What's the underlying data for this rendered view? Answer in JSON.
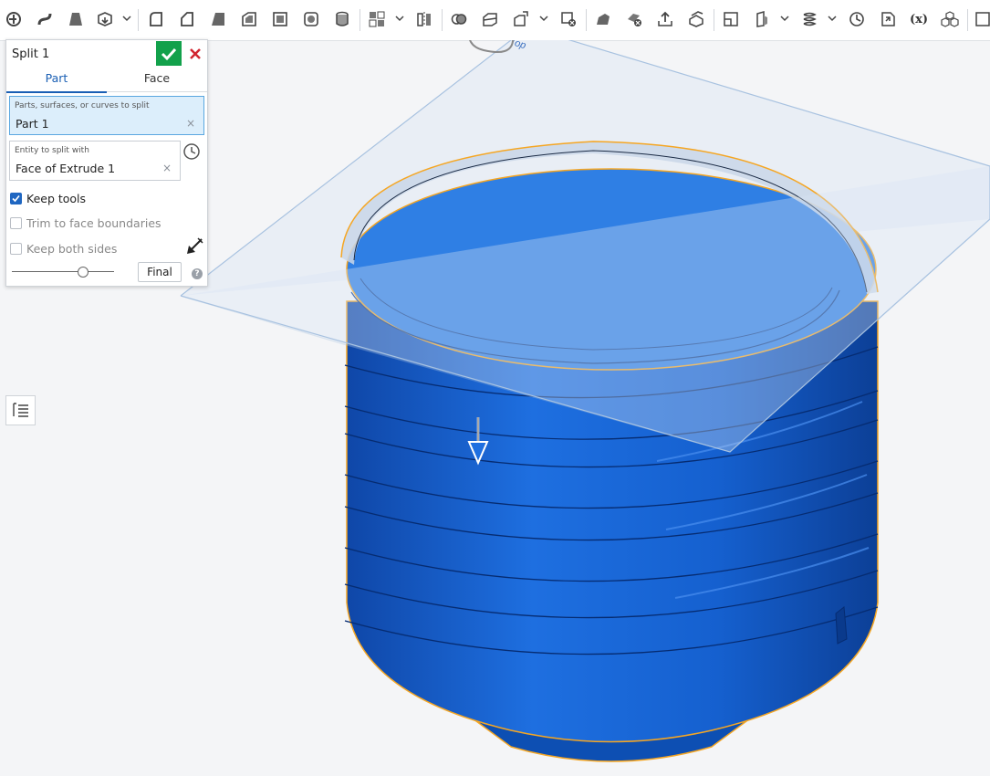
{
  "toolbar": {
    "icons": [
      "sweep-icon",
      "extrude-icon",
      "loft-icon",
      "thicken-icon",
      "fillet-icon",
      "chamfer-icon",
      "draft-icon",
      "shell-icon",
      "hole-icon",
      "rib-icon",
      "cylinder-icon",
      "pattern-icon",
      "mirror-icon",
      "boolean-icon",
      "split-icon",
      "transform-icon",
      "delete-part-icon",
      "modify-fillet-icon",
      "delete-face-icon",
      "move-face-icon",
      "replace-face-icon",
      "plane-icon",
      "mate-connector-icon",
      "helix-icon",
      "measure-icon",
      "import-icon",
      "variable-icon",
      "parts-icon"
    ],
    "variable_label": "(x)"
  },
  "viewport": {
    "plane_label": "Top"
  },
  "dialog": {
    "title": "Split 1",
    "tabs": [
      "Part",
      "Face"
    ],
    "active_tab": "Part",
    "parts_field": {
      "label": "Parts, surfaces, or curves to split",
      "value": "Part 1"
    },
    "entity_field": {
      "label": "Entity to split with",
      "value": "Face of Extrude 1"
    },
    "keep_tools": {
      "label": "Keep tools",
      "checked": true
    },
    "trim": {
      "label": "Trim to face boundaries",
      "checked": false
    },
    "keep_both": {
      "label": "Keep both sides",
      "checked": false
    },
    "final_label": "Final",
    "clear_glyph": "×",
    "help_glyph": "?"
  },
  "colors": {
    "accent": "#1a5fb4",
    "ok_green": "#12a14b",
    "cancel_red": "#d1242f",
    "part_blue": "#1d6ee0",
    "highlight_orange": "#f5a623"
  }
}
